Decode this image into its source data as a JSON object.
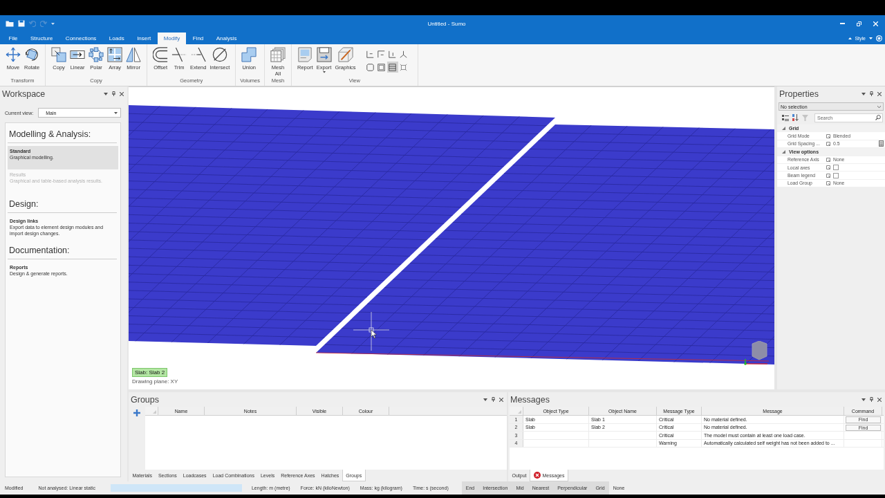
{
  "window": {
    "title": "Untitled - Sumo",
    "style_label": "Style"
  },
  "quick_access": [
    {
      "disabled": false
    },
    {
      "disabled": false
    },
    {
      "disabled": true
    },
    {
      "disabled": true
    }
  ],
  "menu_tabs": [
    {
      "label": "File",
      "selected": false
    },
    {
      "label": "Structure",
      "selected": false
    },
    {
      "label": "Connections",
      "selected": false
    },
    {
      "label": "Loads",
      "selected": false
    },
    {
      "label": "Insert",
      "selected": false
    },
    {
      "label": "Modify",
      "selected": true
    },
    {
      "label": "Find",
      "selected": false
    },
    {
      "label": "Analysis",
      "selected": false
    }
  ],
  "ribbon": [
    {
      "label": "Transform",
      "buttons": [
        {
          "label": "Move"
        },
        {
          "label": "Rotate"
        }
      ]
    },
    {
      "label": "Copy",
      "buttons": [
        {
          "label": "Copy"
        },
        {
          "label": "Linear"
        },
        {
          "label": "Polar"
        },
        {
          "label": "Array"
        },
        {
          "label": "Mirror"
        }
      ]
    },
    {
      "label": "Geometry",
      "buttons": [
        {
          "label": "Offset"
        },
        {
          "label": "Trim"
        },
        {
          "label": "Extend"
        },
        {
          "label": "Intersect"
        }
      ]
    },
    {
      "label": "Volumes",
      "buttons": [
        {
          "label": "Union"
        }
      ]
    },
    {
      "label": "Mesh",
      "buttons": [
        {
          "label": "Mesh All"
        }
      ]
    },
    {
      "label": "View",
      "buttons": [
        {
          "label": "Report"
        },
        {
          "label": "Export",
          "dropdown": true
        },
        {
          "label": "Graphics"
        }
      ],
      "small_buttons": [
        {
          "selected": false
        },
        {
          "selected": false
        },
        {
          "selected": false
        },
        {
          "selected": false
        },
        {
          "selected": false
        },
        {
          "selected": false
        },
        {
          "selected": true
        },
        {
          "selected": false
        }
      ]
    }
  ],
  "workspace": {
    "title": "Workspace",
    "current_view_label": "Current view:",
    "current_view": "Main",
    "sections": [
      {
        "heading": "Modelling & Analysis:",
        "items": [
          {
            "title": "Standard",
            "description": "Graphical modelling.",
            "selected": true,
            "disabled": false
          },
          {
            "title": "Results",
            "description": "Graphical and table-based analysis results.",
            "selected": false,
            "disabled": true
          }
        ]
      },
      {
        "heading": "Design:",
        "items": [
          {
            "title": "Design links",
            "description": "Export data to element design modules and import design changes.",
            "selected": false,
            "disabled": false
          }
        ]
      },
      {
        "heading": "Documentation:",
        "items": [
          {
            "title": "Reports",
            "description": "Design & generate reports.",
            "selected": false,
            "disabled": false
          }
        ]
      }
    ]
  },
  "viewport": {
    "selection_tag": "Slab: Slab 2",
    "drawing_plane": "Drawing plane: XY"
  },
  "properties": {
    "title": "Properties",
    "selection": "No selection",
    "tools": [
      {
        "disabled": false
      },
      {
        "disabled": false
      },
      {
        "disabled": true
      }
    ],
    "search_placeholder": "Search",
    "categories": [
      {
        "name": "Grid",
        "expanded": true,
        "rows": [
          {
            "name": "Grid Mode",
            "kind": "text",
            "value": "Blended"
          },
          {
            "name": "Grid Spacing ...",
            "kind": "number",
            "value": "0.5"
          }
        ]
      },
      {
        "name": "View options",
        "expanded": true,
        "rows": [
          {
            "name": "Reference Axis",
            "kind": "text",
            "value": "None"
          },
          {
            "name": "Local axes",
            "kind": "checkbox",
            "checked": false
          },
          {
            "name": "Beam legend",
            "kind": "checkbox",
            "checked": false
          },
          {
            "name": "Load Group",
            "kind": "text",
            "value": "None"
          }
        ]
      }
    ]
  },
  "groups_panel": {
    "title": "Groups",
    "columns": [
      "Name",
      "Notes",
      "Visible",
      "Colour"
    ],
    "tabs": [
      {
        "label": "Materials",
        "selected": false
      },
      {
        "label": "Sections",
        "selected": false
      },
      {
        "label": "Loadcases",
        "selected": false
      },
      {
        "label": "Load Combinations",
        "selected": false
      },
      {
        "label": "Levels",
        "selected": false
      },
      {
        "label": "Reference Axes",
        "selected": false
      },
      {
        "label": "Hatches",
        "selected": false
      },
      {
        "label": "Groups",
        "selected": true
      }
    ]
  },
  "messages_panel": {
    "title": "Messages",
    "columns": [
      "Object Type",
      "Object Name",
      "Message Type",
      "Message",
      "Command"
    ],
    "rows": [
      {
        "number": "1",
        "object_type": "Slab",
        "object_name": "Slab 1",
        "message_type": "Critical",
        "message": "No material defined.",
        "command": "Find"
      },
      {
        "number": "2",
        "object_type": "Slab",
        "object_name": "Slab 2",
        "message_type": "Critical",
        "message": "No material defined.",
        "command": "Find"
      },
      {
        "number": "3",
        "message_type": "Critical",
        "message": "The model must contain at least one load case."
      },
      {
        "number": "4",
        "message_type": "Warning",
        "message": "Automatically calculated self weight has not been added to ..."
      }
    ],
    "tabs": [
      {
        "label": "Output",
        "selected": false,
        "alert": false
      },
      {
        "label": "Messages",
        "selected": true,
        "alert": true
      }
    ]
  },
  "status_bar": {
    "state": "Modified",
    "analysis": "Not analysed: Linear static",
    "progress": {
      "level": 1
    },
    "units": [
      "Length: m (metre)",
      "Force: kN (kiloNewton)",
      "Mass: kg (kilogram)",
      "Time: s (second)"
    ],
    "snaps": [
      {
        "label": "End",
        "on": true
      },
      {
        "label": "Intersection",
        "on": true
      },
      {
        "label": "Mid",
        "on": true
      },
      {
        "label": "Nearest",
        "on": true
      },
      {
        "label": "Perpendicular",
        "on": true
      },
      {
        "label": "Grid",
        "on": true
      },
      {
        "label": "None",
        "on": false
      }
    ]
  }
}
